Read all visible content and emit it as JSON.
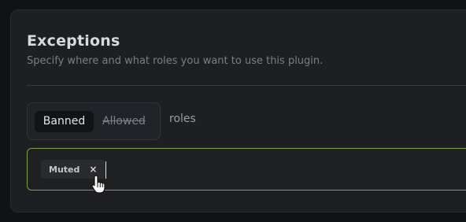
{
  "section": {
    "title": "Exceptions",
    "subtitle": "Specify where and what roles you want to use this plugin."
  },
  "role_mode": {
    "options": [
      "Banned",
      "Allowed"
    ],
    "selected": "Banned",
    "suffix_label": "roles"
  },
  "role_tags": {
    "items": [
      {
        "label": "Muted",
        "remove_label": "×"
      }
    ]
  },
  "colors": {
    "accent": "#7ea24a",
    "panel_bg": "#1e1f22",
    "page_bg": "#111215"
  },
  "icons": {
    "cursor": "hand-pointer-icon",
    "remove": "close-icon"
  }
}
